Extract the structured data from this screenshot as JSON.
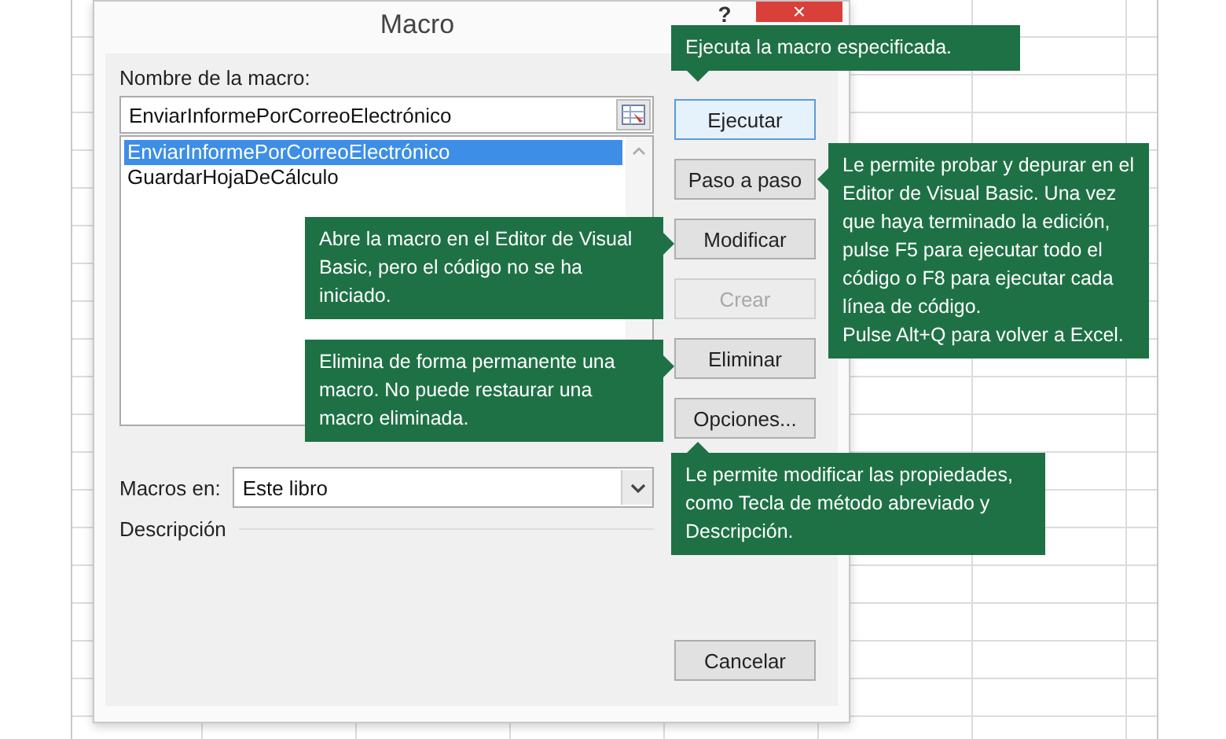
{
  "window": {
    "title": "Macro",
    "help": "?",
    "close": "×"
  },
  "macro_name": {
    "label": "Nombre de la macro:",
    "value": "EnviarInformePorCorreoElectrónico"
  },
  "macro_list": [
    {
      "name": "EnviarInformePorCorreoElectrónico",
      "selected": true
    },
    {
      "name": "GuardarHojaDeCálculo",
      "selected": false
    }
  ],
  "buttons": [
    {
      "label": "Ejecutar",
      "default": true,
      "disabled": false
    },
    {
      "label": "Paso a paso",
      "default": false,
      "disabled": false
    },
    {
      "label": "Modificar",
      "default": false,
      "disabled": false
    },
    {
      "label": "Crear",
      "default": false,
      "disabled": true
    },
    {
      "label": "Eliminar",
      "default": false,
      "disabled": false
    },
    {
      "label": "Opciones...",
      "default": false,
      "disabled": false
    }
  ],
  "macros_in": {
    "label": "Macros en:",
    "value": "Este libro"
  },
  "description": {
    "label": "Descripción"
  },
  "cancel_button": {
    "label": "Cancelar"
  },
  "tooltips": [
    {
      "text": "Ejecuta la macro especificada."
    },
    {
      "text": "Abre la macro en el Editor de Visual Basic, pero el código no se ha iniciado."
    },
    {
      "text": "Elimina de forma permanente una macro. No puede restaurar una macro eliminada."
    },
    {
      "text": "Le permite probar y depurar en el Editor de Visual Basic. Una vez que haya terminado la edición, pulse F5 para ejecutar todo el código o F8 para ejecutar cada línea de código.\nPulse Alt+Q para volver a Excel."
    },
    {
      "text": "Le permite modificar las propiedades, como Tecla de método abreviado y Descripción."
    }
  ]
}
